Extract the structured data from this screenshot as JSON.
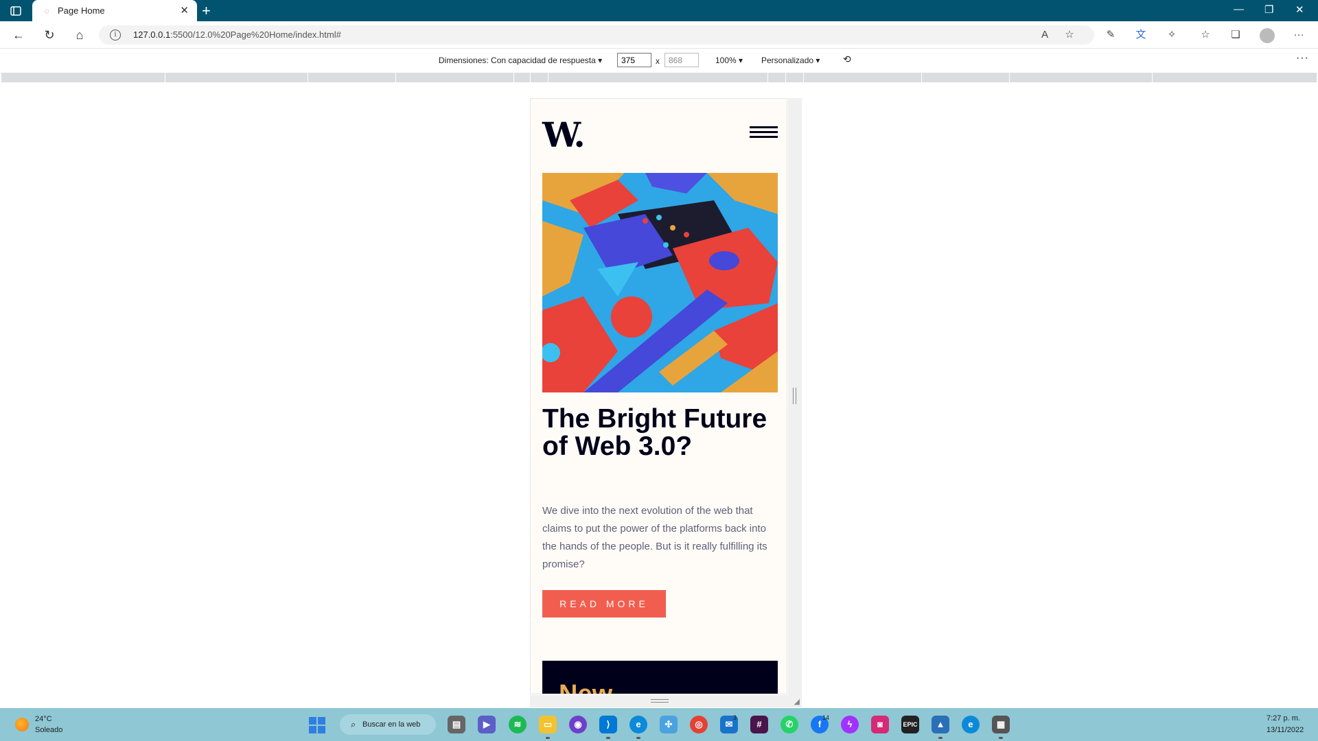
{
  "browser": {
    "tab_title": "Page Home",
    "url_host": "127.0.0.1",
    "url_rest": ":5500/12.0%20Page%20Home/index.html#"
  },
  "devtools": {
    "dimensions_label": "Dimensiones: Con capacidad de respuesta",
    "width_value": "375",
    "height_value": "868",
    "times": "x",
    "zoom": "100%",
    "throttle": "Personalizado"
  },
  "page": {
    "logo": "W.",
    "headline": "The Bright Future of Web 3.0?",
    "description": "We dive into the next evolution of the web that claims to put the power of the platforms back into the hands of the people. But is it really fulfilling its promise?",
    "cta_label": "READ MORE",
    "new_section_title": "New"
  },
  "colors": {
    "soft_red": "#f15e50",
    "soft_orange": "#e9ab53",
    "off_white": "#fffcf7",
    "very_dark_blue": "#00001a",
    "grayish_blue": "#5d5f79",
    "titlebar": "#02536f",
    "taskbar": "#8fc7d4"
  },
  "taskbar": {
    "weather_temp": "24°C",
    "weather_desc": "Soleado",
    "search_label": "Buscar en la web",
    "mail_badge": "3",
    "facebook_badge": "14",
    "time": "7:27 p. m.",
    "date": "13/11/2022",
    "apps": [
      "task-view",
      "teams-chat",
      "spotify",
      "file-explorer",
      "github",
      "vscode",
      "edge",
      "pinwheel",
      "chrome",
      "mail",
      "slack",
      "whatsapp",
      "facebook",
      "messenger",
      "instagram",
      "epic-games",
      "photos",
      "edge-beta",
      "calculator"
    ]
  }
}
